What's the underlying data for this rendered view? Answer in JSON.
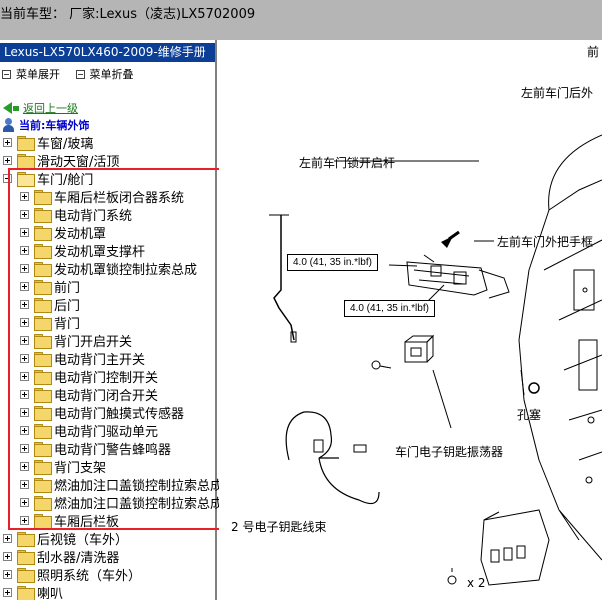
{
  "window": {
    "title": "当前车型： 厂家:Lexus（凌志)LX5702009"
  },
  "sidebar": {
    "manual_title": "Lexus-LX570LX460-2009-维修手册",
    "menu_expand": "菜单展开",
    "menu_collapse": "菜单折叠",
    "back_link": "返回上一级",
    "current_label": "当前:车辆外饰",
    "tree": [
      {
        "label": "车窗/玻璃",
        "level": 0,
        "expanded": false
      },
      {
        "label": "滑动天窗/活顶",
        "level": 0,
        "expanded": false
      },
      {
        "label": "车门/舱门",
        "level": 0,
        "expanded": true
      },
      {
        "label": "车厢后栏板闭合器系统",
        "level": 1,
        "expanded": false
      },
      {
        "label": "电动背门系统",
        "level": 1,
        "expanded": false
      },
      {
        "label": "发动机罩",
        "level": 1,
        "expanded": false
      },
      {
        "label": "发动机罩支撑杆",
        "level": 1,
        "expanded": false
      },
      {
        "label": "发动机罩锁控制拉索总成",
        "level": 1,
        "expanded": false
      },
      {
        "label": "前门",
        "level": 1,
        "expanded": false
      },
      {
        "label": "后门",
        "level": 1,
        "expanded": false
      },
      {
        "label": "背门",
        "level": 1,
        "expanded": false
      },
      {
        "label": "背门开启开关",
        "level": 1,
        "expanded": false
      },
      {
        "label": "电动背门主开关",
        "level": 1,
        "expanded": false
      },
      {
        "label": "电动背门控制开关",
        "level": 1,
        "expanded": false
      },
      {
        "label": "电动背门闭合开关",
        "level": 1,
        "expanded": false
      },
      {
        "label": "电动背门触摸式传感器",
        "level": 1,
        "expanded": false
      },
      {
        "label": "电动背门驱动单元",
        "level": 1,
        "expanded": false
      },
      {
        "label": "电动背门警告蜂鸣器",
        "level": 1,
        "expanded": false
      },
      {
        "label": "背门支架",
        "level": 1,
        "expanded": false
      },
      {
        "label": "燃油加注口盖锁控制拉索总成",
        "level": 1,
        "expanded": false
      },
      {
        "label": "燃油加注口盖锁控制拉索总成",
        "level": 1,
        "expanded": false
      },
      {
        "label": "车厢后栏板",
        "level": 1,
        "expanded": false
      },
      {
        "label": "后视镜（车外）",
        "level": 0,
        "expanded": false
      },
      {
        "label": "刮水器/清洗器",
        "level": 0,
        "expanded": false
      },
      {
        "label": "照明系统（车外）",
        "level": 0,
        "expanded": false
      },
      {
        "label": "喇叭",
        "level": 0,
        "expanded": false
      }
    ]
  },
  "diagram": {
    "labels": {
      "front_door_rear_top": "左前车门后外",
      "lock_opening": "左前车门锁开启杆",
      "outside_handle": "左前车门外把手框",
      "hole_plug": "孔塞",
      "oscillator": "车门电子钥匙振荡器",
      "wire_harness": "2 号电子钥匙线束",
      "times_two": "x 2",
      "top_right_char": "前"
    },
    "torque_1": "4.0 (41, 35 in.*lbf)",
    "torque_2": "4.0 (41, 35 in.*lbf)"
  },
  "colors": {
    "titlebar_bg": "#b5b5b5",
    "manual_title_bg": "#0b3e94",
    "highlight_border": "#e8202a"
  }
}
